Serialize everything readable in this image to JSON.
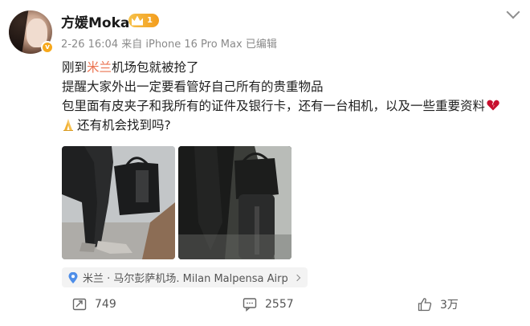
{
  "post": {
    "author": "方媛Moka",
    "level": "1",
    "meta": "2-26 16:04  来自 iPhone 16 Pro Max 已编辑",
    "lines": {
      "l1_pre": "刚到",
      "l1_link": "米兰",
      "l1_post": "机场包就被抢了",
      "l2": "提醒大家外出一定要看管好自己所有的贵重物品",
      "l3": "包里面有皮夹子和我所有的证件及银行卡，还有一台相机，以及一些重要资料",
      "l4": "还有机会找到吗?"
    },
    "location": "米兰 · 马尔彭萨机场. Milan Malpensa Airp"
  },
  "actions": {
    "repost_count": "749",
    "comment_count": "2557",
    "like_count": "3万"
  },
  "colors": {
    "link": "#eb7350",
    "level_badge": "#f39d1d",
    "verified": "#f7a81b"
  },
  "icons": [
    "chevron-down-icon",
    "crown-icon",
    "broken-heart-icon",
    "pray-icon",
    "location-pin-icon",
    "repost-icon",
    "comment-icon",
    "like-icon"
  ]
}
